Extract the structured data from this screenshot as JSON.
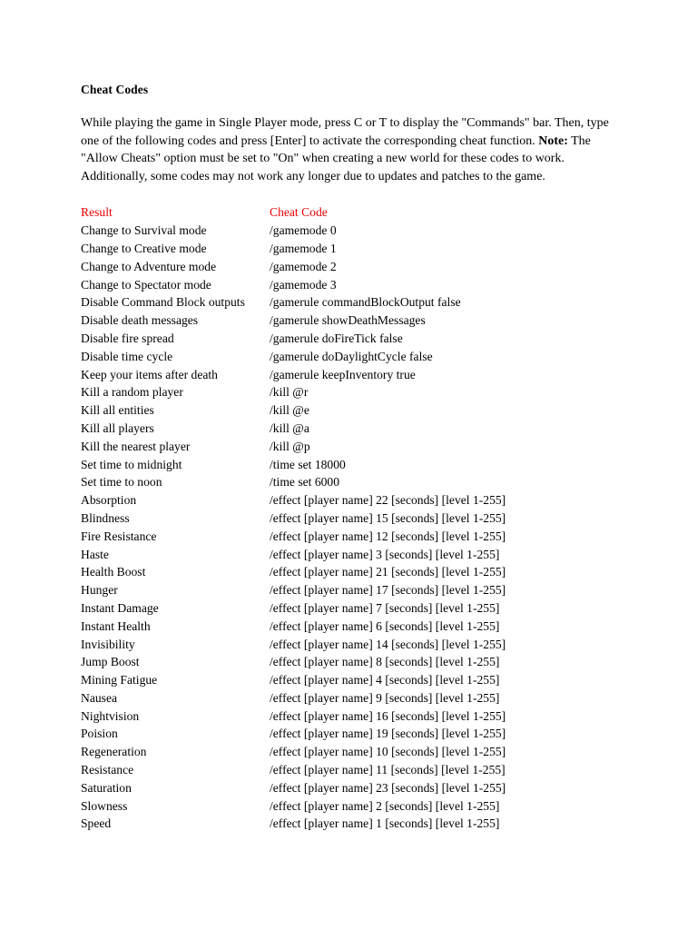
{
  "document": {
    "title": "Cheat Codes",
    "intro_parts": [
      {
        "text": "While playing the game in Single Player mode, press C or T to display the \"Commands\" bar. Then, type one of the following codes and press [Enter] to activate the corresponding cheat function. ",
        "bold": false
      },
      {
        "text": "Note:",
        "bold": true
      },
      {
        "text": " The \"Allow Cheats\" option must be set to \"On\" when creating a new world for these codes to work. Additionally, some codes may not work any longer due to updates and patches to the game.",
        "bold": false
      }
    ]
  },
  "colors": {
    "header_red": "#ee0000",
    "body_text": "#000000",
    "page_background": "#ffffff"
  },
  "table": {
    "headers": {
      "result": "Result",
      "code": "Cheat Code"
    },
    "rows": [
      {
        "result": "Change to Survival mode",
        "code": [
          {
            "t": "/gamemode 0",
            "b": true
          }
        ]
      },
      {
        "result": "Change to Creative mode",
        "code": [
          {
            "t": "/gamemode 1",
            "b": true
          }
        ]
      },
      {
        "result": "Change to Adventure mode",
        "code": [
          {
            "t": "/gamemode 2",
            "b": true
          }
        ]
      },
      {
        "result": "Change to Spectator mode",
        "code": [
          {
            "t": "/gamemode 3",
            "b": true
          }
        ]
      },
      {
        "result": "Disable Command Block outputs",
        "wide": true,
        "code": [
          {
            "t": "/gamerule commandBlockOutput false",
            "b": true
          }
        ]
      },
      {
        "result": "Disable death messages",
        "code": [
          {
            "t": "/gamerule showDeathMessages",
            "b": true
          }
        ]
      },
      {
        "result": "Disable fire spread",
        "code": [
          {
            "t": "/gamerule doFireTick false",
            "b": true
          }
        ]
      },
      {
        "result": "Disable time cycle",
        "code": [
          {
            "t": "/gamerule doDaylightCycle false",
            "b": true
          }
        ]
      },
      {
        "result": "Keep your items after death",
        "code": [
          {
            "t": "/gamerule keepInventory true",
            "b": true
          }
        ]
      },
      {
        "result": "Kill a random player",
        "code": [
          {
            "t": "/kill @r",
            "b": true
          }
        ]
      },
      {
        "result": "Kill all entities",
        "code": [
          {
            "t": "/kill @e",
            "b": true
          }
        ]
      },
      {
        "result": "Kill all players",
        "code": [
          {
            "t": "/kill @a",
            "b": true
          }
        ]
      },
      {
        "result": "Kill the nearest player",
        "code": [
          {
            "t": "/kill @p",
            "b": true
          }
        ]
      },
      {
        "result": "Set time to midnight",
        "code": [
          {
            "t": "/time set 18000",
            "b": true
          }
        ]
      },
      {
        "result": "Set time to noon",
        "code": [
          {
            "t": "/time set 6000",
            "b": true
          }
        ]
      },
      {
        "result": "Absorption",
        "code": [
          {
            "t": "/effect",
            "b": true
          },
          {
            "t": " [player name] ",
            "b": false
          },
          {
            "t": "22",
            "b": true
          },
          {
            "t": " [seconds] [level 1-255]",
            "b": false
          }
        ]
      },
      {
        "result": "Blindness",
        "code": [
          {
            "t": "/effect",
            "b": true
          },
          {
            "t": " [player name] ",
            "b": false
          },
          {
            "t": "15",
            "b": true
          },
          {
            "t": " [seconds] [level 1-255]",
            "b": false
          }
        ]
      },
      {
        "result": "Fire Resistance",
        "code": [
          {
            "t": "/effect",
            "b": true
          },
          {
            "t": " [player name] ",
            "b": false
          },
          {
            "t": "12",
            "b": true
          },
          {
            "t": " [seconds] [level 1-255]",
            "b": false
          }
        ]
      },
      {
        "result": "Haste",
        "code": [
          {
            "t": "/effect",
            "b": true
          },
          {
            "t": " [player name] ",
            "b": false
          },
          {
            "t": "3",
            "b": true
          },
          {
            "t": " [seconds] [level 1-255]",
            "b": false
          }
        ]
      },
      {
        "result": "Health Boost",
        "code": [
          {
            "t": "/effect",
            "b": true
          },
          {
            "t": " [player name] ",
            "b": false
          },
          {
            "t": "21",
            "b": true
          },
          {
            "t": " [seconds] [level 1-255]",
            "b": false
          }
        ]
      },
      {
        "result": "Hunger",
        "code": [
          {
            "t": "/effect",
            "b": true
          },
          {
            "t": " [player name] ",
            "b": false
          },
          {
            "t": "17",
            "b": true
          },
          {
            "t": " [seconds] [level 1-255]",
            "b": false
          }
        ]
      },
      {
        "result": "Instant Damage",
        "code": [
          {
            "t": "/effect",
            "b": true
          },
          {
            "t": " [player name] ",
            "b": false
          },
          {
            "t": "7",
            "b": true
          },
          {
            "t": " [seconds] [level 1-255]",
            "b": false
          }
        ]
      },
      {
        "result": "Instant Health",
        "code": [
          {
            "t": "/effect",
            "b": true
          },
          {
            "t": " [player name] ",
            "b": false
          },
          {
            "t": "6",
            "b": true
          },
          {
            "t": " [seconds] [level 1-255]",
            "b": false
          }
        ]
      },
      {
        "result": "Invisibility",
        "code": [
          {
            "t": "/effect",
            "b": true
          },
          {
            "t": " [player name] ",
            "b": false
          },
          {
            "t": "14",
            "b": true
          },
          {
            "t": " [seconds] [level 1-255]",
            "b": false
          }
        ]
      },
      {
        "result": "Jump Boost",
        "code": [
          {
            "t": "/effect",
            "b": true
          },
          {
            "t": " [player name] ",
            "b": false
          },
          {
            "t": "8",
            "b": true
          },
          {
            "t": " [seconds] [level 1-255]",
            "b": false
          }
        ]
      },
      {
        "result": "Mining Fatigue",
        "code": [
          {
            "t": "/effect",
            "b": true
          },
          {
            "t": " [player name] ",
            "b": false
          },
          {
            "t": "4",
            "b": true
          },
          {
            "t": " [seconds] [level 1-255]",
            "b": false
          }
        ]
      },
      {
        "result": "Nausea",
        "code": [
          {
            "t": "/effect",
            "b": true
          },
          {
            "t": " [player name] ",
            "b": false
          },
          {
            "t": "9",
            "b": true
          },
          {
            "t": " [seconds] [level 1-255]",
            "b": false
          }
        ]
      },
      {
        "result": "Nightvision",
        "code": [
          {
            "t": "/effect",
            "b": true
          },
          {
            "t": " [player name] ",
            "b": false
          },
          {
            "t": "16",
            "b": true
          },
          {
            "t": " [seconds] [level 1-255]",
            "b": false
          }
        ]
      },
      {
        "result": "Poision",
        "code": [
          {
            "t": "/effect",
            "b": true
          },
          {
            "t": " [player name] ",
            "b": false
          },
          {
            "t": "19",
            "b": true
          },
          {
            "t": " [seconds] [level 1-255]",
            "b": false
          }
        ]
      },
      {
        "result": "Regeneration",
        "code": [
          {
            "t": "/effect",
            "b": true
          },
          {
            "t": " [player name] ",
            "b": false
          },
          {
            "t": "10",
            "b": true
          },
          {
            "t": " [seconds] [level 1-255]",
            "b": false
          }
        ]
      },
      {
        "result": "Resistance",
        "code": [
          {
            "t": "/effect",
            "b": true
          },
          {
            "t": " [player name] ",
            "b": false
          },
          {
            "t": "11",
            "b": true
          },
          {
            "t": " [seconds] [level 1-255]",
            "b": false
          }
        ]
      },
      {
        "result": "Saturation",
        "code": [
          {
            "t": "/effect",
            "b": true
          },
          {
            "t": " [player name] ",
            "b": false
          },
          {
            "t": "23",
            "b": true
          },
          {
            "t": " [seconds] [level 1-255]",
            "b": false
          }
        ]
      },
      {
        "result": "Slowness",
        "code": [
          {
            "t": "/effect",
            "b": true
          },
          {
            "t": " [player name] ",
            "b": false
          },
          {
            "t": "2",
            "b": true
          },
          {
            "t": " [seconds] [level 1-255]",
            "b": false
          }
        ]
      },
      {
        "result": "Speed",
        "code": [
          {
            "t": "/effect",
            "b": true
          },
          {
            "t": " [player name] ",
            "b": false
          },
          {
            "t": "1",
            "b": true
          },
          {
            "t": " [seconds] [level 1-255]",
            "b": false
          }
        ]
      }
    ]
  }
}
